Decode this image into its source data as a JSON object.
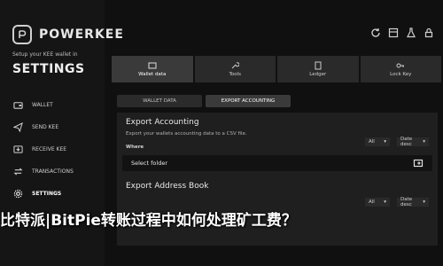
{
  "brand": {
    "name": "POWERKEE"
  },
  "sidebar": {
    "kicker": "Setup your KEE wallet in",
    "section_title": "SETTINGS",
    "items": [
      {
        "label": "WALLET",
        "icon": "wallet-icon"
      },
      {
        "label": "SEND KEE",
        "icon": "send-icon"
      },
      {
        "label": "RECEIVE KEE",
        "icon": "receive-icon"
      },
      {
        "label": "TRANSACTIONS",
        "icon": "transactions-icon"
      },
      {
        "label": "SETTINGS",
        "icon": "settings-icon"
      }
    ]
  },
  "header": {
    "window_icons": [
      "refresh-icon",
      "layout-icon",
      "flask-icon",
      "lock-icon"
    ]
  },
  "tabs": [
    {
      "label": "Wallet data",
      "icon": "wallet-data-icon"
    },
    {
      "label": "Tools",
      "icon": "tools-icon"
    },
    {
      "label": "Ledger",
      "icon": "ledger-icon"
    },
    {
      "label": "Lock Key",
      "icon": "key-icon"
    }
  ],
  "subtabs": [
    {
      "label": "WALLET DATA"
    },
    {
      "label": "EXPORT ACCOUNTING"
    }
  ],
  "export_accounting": {
    "title": "Export Accounting",
    "description": "Export your wallets accounting data to a CSV file.",
    "where_label": "Where",
    "filter_value": "All",
    "sort_value": "Date desc",
    "folder_placeholder": "Select folder"
  },
  "export_address_book": {
    "title": "Export Address Book",
    "filter_value": "All",
    "sort_value": "Date desc"
  },
  "overlay_text": "比特派|BitPie转账过程中如何处理矿工费？",
  "colors": {
    "background": "#101010",
    "panel": "#1f1f1f"
  }
}
